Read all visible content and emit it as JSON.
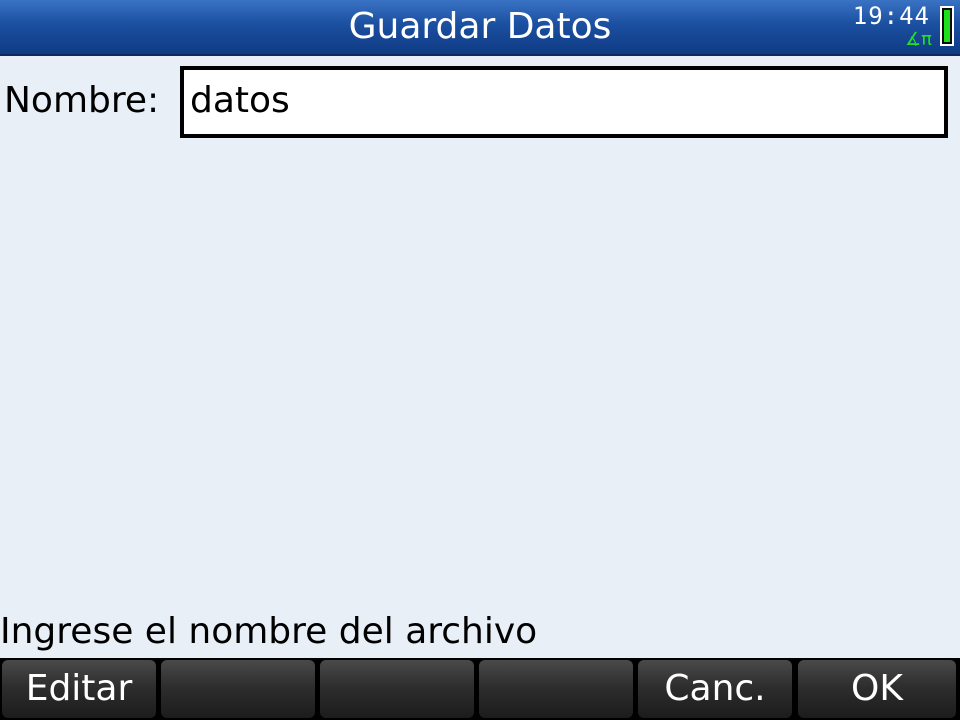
{
  "window": {
    "title": "Guardar Datos"
  },
  "status": {
    "time": "19:44",
    "angle_mode": "∡π",
    "battery_level": 1.0
  },
  "form": {
    "name_label": "Nombre:",
    "name_value": "datos"
  },
  "help": {
    "text": "Ingrese el nombre del archivo"
  },
  "softkeys": [
    {
      "label": "Editar"
    },
    {
      "label": ""
    },
    {
      "label": ""
    },
    {
      "label": ""
    },
    {
      "label": "Canc."
    },
    {
      "label": "OK"
    }
  ],
  "colors": {
    "titlebar": "#1b4fa0",
    "background": "#e8eff7",
    "battery": "#1de01d",
    "angle_mode": "#22e022"
  }
}
